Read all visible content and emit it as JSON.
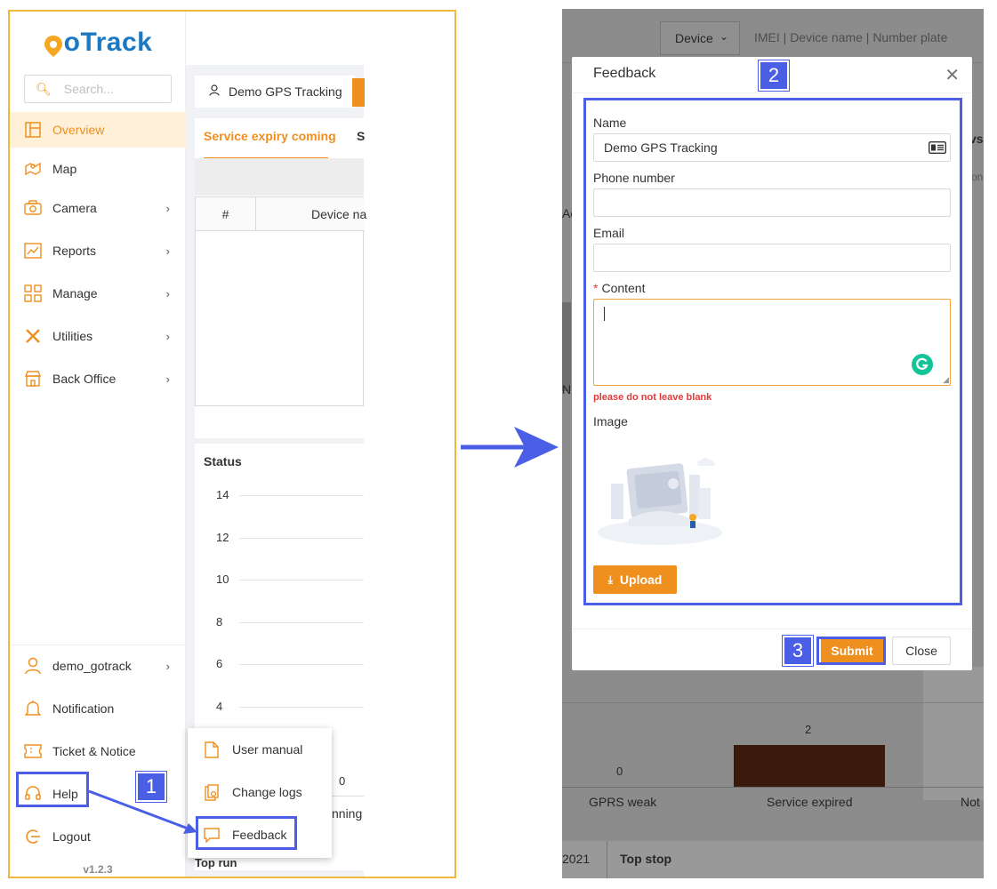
{
  "app": {
    "brand_first": "G",
    "brand_rest": "oTrack",
    "brand_color": "#1b78c2",
    "accent_color": "#ef8f1e",
    "version": "v1.2.3"
  },
  "sidebar": {
    "search_placeholder": "Search...",
    "items": [
      {
        "label": "Overview",
        "icon": "overview-icon"
      },
      {
        "label": "Map",
        "icon": "map-icon"
      },
      {
        "label": "Camera",
        "icon": "camera-icon"
      },
      {
        "label": "Reports",
        "icon": "reports-icon"
      },
      {
        "label": "Manage",
        "icon": "manage-icon"
      },
      {
        "label": "Utilities",
        "icon": "utilities-icon"
      },
      {
        "label": "Back Office",
        "icon": "store-icon"
      }
    ],
    "bottom_items": [
      {
        "label": "demo_gotrack",
        "icon": "user-icon"
      },
      {
        "label": "Notification",
        "icon": "bell-icon"
      },
      {
        "label": "Ticket & Notice",
        "icon": "ticket-icon"
      },
      {
        "label": "Help",
        "icon": "headset-icon"
      },
      {
        "label": "Logout",
        "icon": "logout-icon"
      }
    ]
  },
  "dashboard": {
    "account_tab": "Demo GPS Tracking",
    "tab_active": "Service expiry coming",
    "tab_next": "S",
    "table_headers": [
      "#",
      "Device na"
    ],
    "status_title": "Status",
    "y_ticks": [
      "14",
      "12",
      "10",
      "8",
      "6",
      "4"
    ],
    "zero_label": "0",
    "partial_label": "nning",
    "top_run": "Top run"
  },
  "help_menu": {
    "items": [
      {
        "label": "User manual",
        "icon": "document-icon"
      },
      {
        "label": "Change logs",
        "icon": "changelog-icon"
      },
      {
        "label": "Feedback",
        "icon": "feedback-icon"
      }
    ]
  },
  "annotations": {
    "step1": "1",
    "step2": "2",
    "step3": "3"
  },
  "background_page": {
    "device_select": "Device",
    "search_placeholder": "IMEI | Device name | Number plate",
    "partial_ws": "vs",
    "partial_onl": "onl",
    "partial_ac": "Ac",
    "partial_n": "N",
    "bar_labels": [
      "GPRS weak",
      "Service expired",
      "Not"
    ],
    "bar_values": [
      "0",
      "2"
    ],
    "bar_color": "#3a1a0c",
    "year_label": "2021",
    "top_stop": "Top stop"
  },
  "feedback_modal": {
    "title": "Feedback",
    "name_label": "Name",
    "name_value": "Demo GPS Tracking",
    "phone_label": "Phone number",
    "phone_value": "",
    "email_label": "Email",
    "email_value": "",
    "content_required_mark": "*",
    "content_label": "Content",
    "content_error": "please do not leave blank",
    "image_label": "Image",
    "upload_label": "Upload",
    "submit_label": "Submit",
    "close_label": "Close"
  }
}
